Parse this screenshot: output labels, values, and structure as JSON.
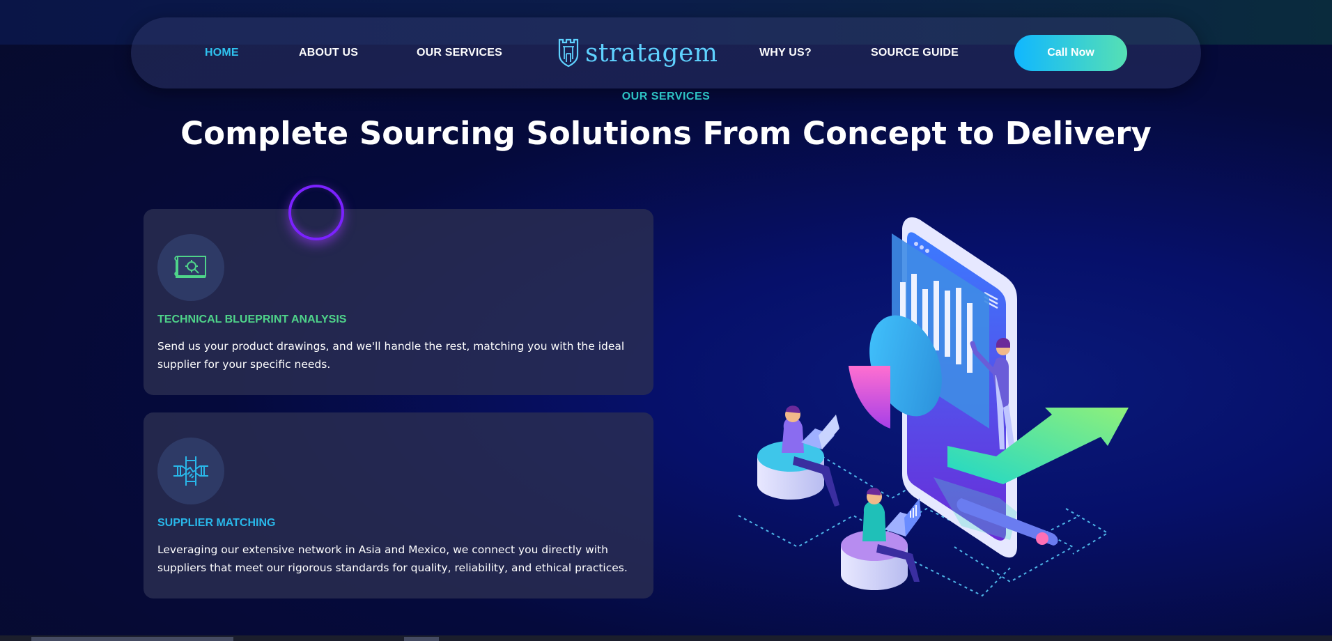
{
  "nav": {
    "links": [
      {
        "label": "HOME",
        "active": true
      },
      {
        "label": "ABOUT US"
      },
      {
        "label": "OUR SERVICES"
      },
      {
        "label": "WHY US?"
      },
      {
        "label": "SOURCE GUIDE"
      }
    ],
    "logo_text": "stratagem",
    "cta_label": "Call Now"
  },
  "section": {
    "eyebrow": "OUR SERVICES",
    "headline": "Complete Sourcing Solutions From Concept to Delivery"
  },
  "cards": [
    {
      "icon": "blueprint-icon",
      "title": "TECHNICAL BLUEPRINT ANALYSIS",
      "title_color": "#4fd48a",
      "text": "Send us your product drawings, and we'll handle the rest, matching you with the ideal supplier for your specific needs."
    },
    {
      "icon": "handshake-icon",
      "title": "SUPPLIER MATCHING",
      "title_color": "#29b8ea",
      "text": "Leveraging our extensive network in Asia and Mexico, we connect you directly with suppliers that meet our rigorous standards for quality, reliability, and ethical practices."
    }
  ],
  "colors": {
    "accent": "#2fc3f0",
    "cta_start": "#10b7ff",
    "cta_end": "#56e0b4",
    "background": "#050a3c"
  }
}
